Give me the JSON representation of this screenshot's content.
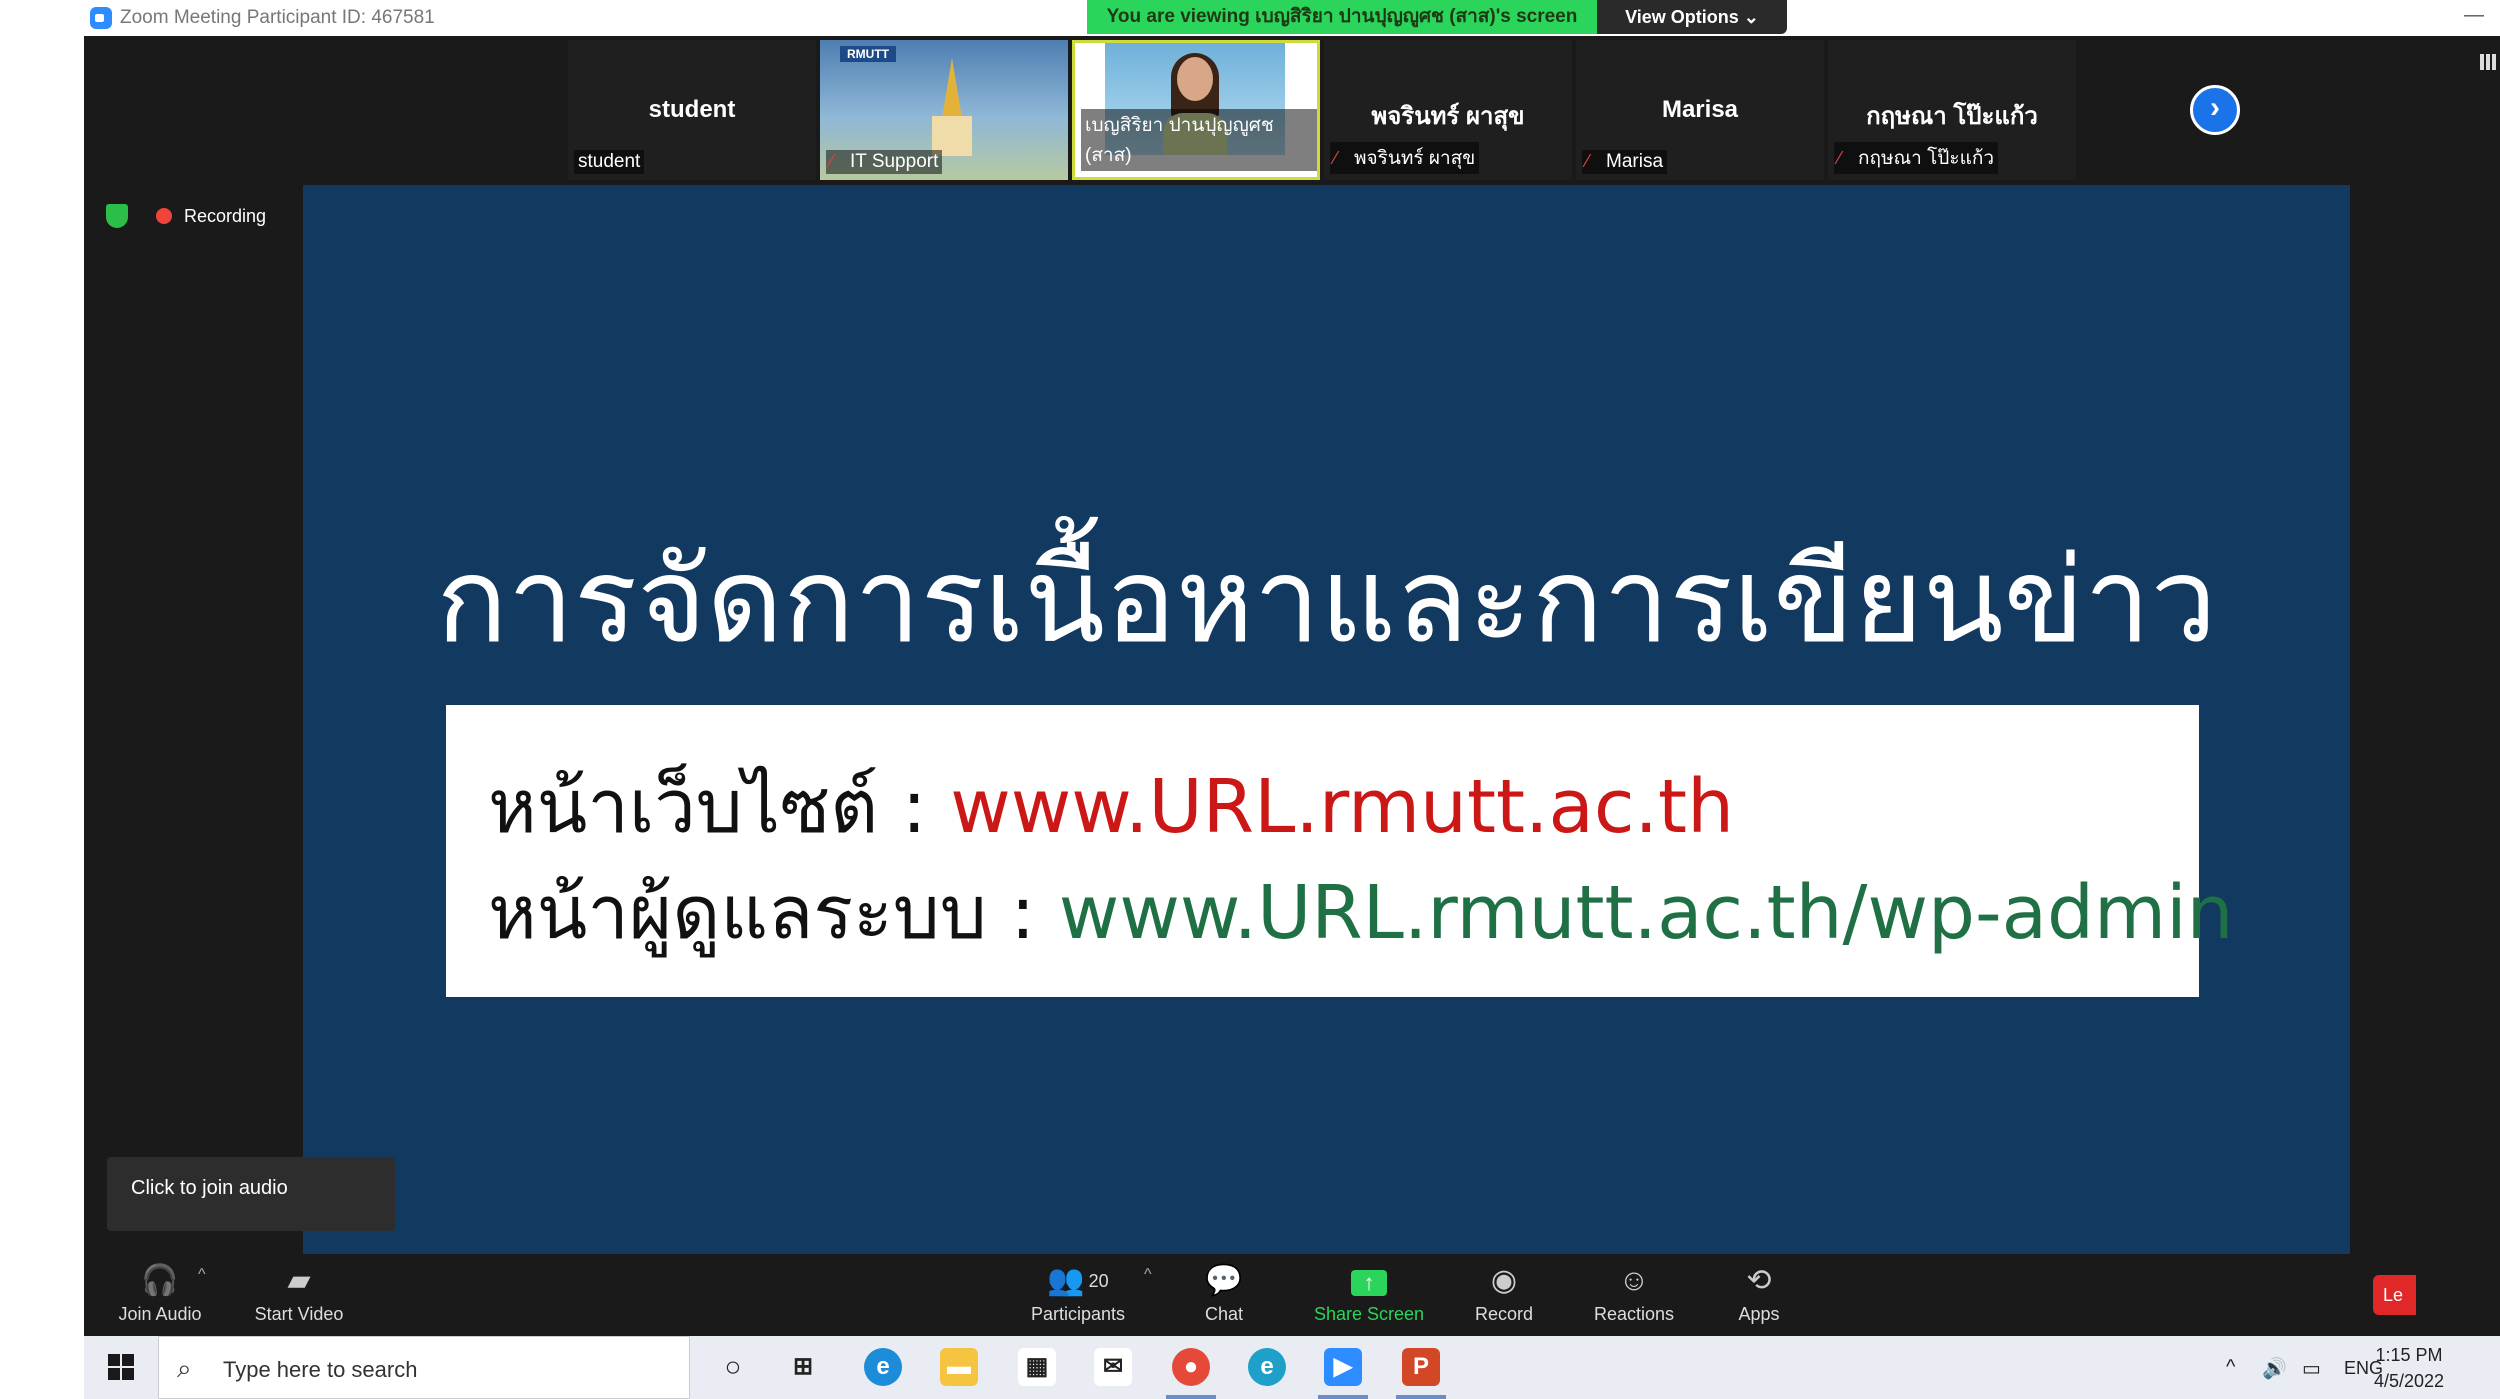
{
  "titlebar": {
    "title": "Zoom Meeting Participant ID: 467581",
    "viewing_banner": "You are viewing เบญสิริยา ปานปุญญูศช (สาส)'s screen",
    "view_options": "View Options ⌄"
  },
  "gallery": {
    "tiles": [
      {
        "name": "student",
        "label": "student"
      },
      {
        "label": "IT Support",
        "logo_text": "RMUTT"
      },
      {
        "label": "เบญสิริยา ปานปุญญูศช (สาส)"
      },
      {
        "name": "พจรินทร์ ผาสุข",
        "label": "พจรินทร์ ผาสุข"
      },
      {
        "name": "Marisa",
        "label": "Marisa"
      },
      {
        "name": "กฤษณา โป๊ะแก้ว",
        "label": "กฤษณา โป๊ะแก้ว"
      }
    ],
    "next_icon": "›"
  },
  "status": {
    "recording": "Recording"
  },
  "slide": {
    "title": "การจัดการเนื้อหาและการเขียนข่าว",
    "line1_label": "หน้าเว็บไซต์   : ",
    "line1_url": "www.URL.rmutt.ac.th",
    "line2_label": "หน้าผู้ดูแลระบบ : ",
    "line2_url": "www.URL.rmutt.ac.th/wp-admin",
    "bg_color": "#12395f"
  },
  "tooltip": {
    "text": "Click to join audio"
  },
  "toolbar": {
    "join_audio": "Join Audio",
    "start_video": "Start Video",
    "participants": "Participants",
    "participants_count": "20",
    "chat": "Chat",
    "share_screen": "Share Screen",
    "record": "Record",
    "reactions": "Reactions",
    "apps": "Apps",
    "leave": "Le"
  },
  "taskbar": {
    "search_placeholder": "Type here to search",
    "lang": "ENG",
    "time": "1:15 PM",
    "date": "4/5/2022"
  }
}
